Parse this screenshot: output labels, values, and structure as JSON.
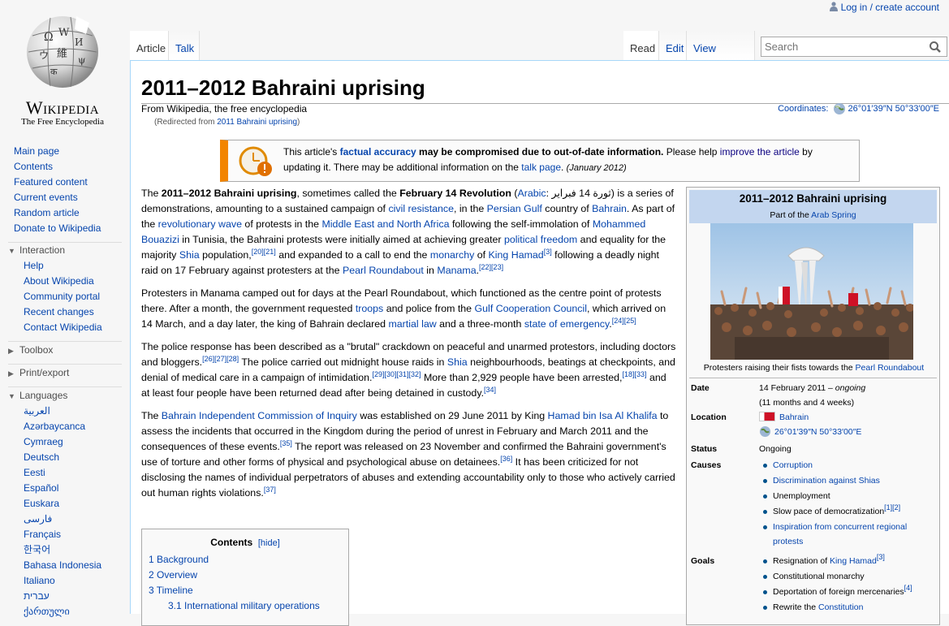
{
  "site": {
    "wordmark": "Wikipedia",
    "tagline": "The Free Encyclopedia"
  },
  "personal": {
    "login": "Log in / create account"
  },
  "nav_main": [
    "Main page",
    "Contents",
    "Featured content",
    "Current events",
    "Random article",
    "Donate to Wikipedia"
  ],
  "interaction": {
    "title": "Interaction",
    "items": [
      "Help",
      "About Wikipedia",
      "Community portal",
      "Recent changes",
      "Contact Wikipedia"
    ]
  },
  "toolbox": {
    "title": "Toolbox"
  },
  "printexport": {
    "title": "Print/export"
  },
  "languages": {
    "title": "Languages",
    "items": [
      "العربية",
      "Azərbaycanca",
      "Cymraeg",
      "Deutsch",
      "Eesti",
      "Español",
      "Euskara",
      "فارسی",
      "Français",
      "한국어",
      "Bahasa Indonesia",
      "Italiano",
      "עברית",
      "ქართული"
    ]
  },
  "tabs": {
    "article": "Article",
    "talk": "Talk",
    "read": "Read",
    "edit": "Edit",
    "history": "View history"
  },
  "search": {
    "placeholder": "Search"
  },
  "page": {
    "title": "2011–2012 Bahraini uprising",
    "site_sub": "From Wikipedia, the free encyclopedia",
    "redirect_pre": "(Redirected from ",
    "redirect_link": "2011 Bahraini uprising",
    "redirect_post": ")",
    "coords_label": "Coordinates:",
    "coords_value": "26°01′39″N 50°33′00″E"
  },
  "ambox": {
    "t1": "This article's ",
    "l1": "factual accuracy",
    "t2": " may be compromised due to out-of-date information.",
    "t3": " Please help ",
    "l2": "improve the article",
    "t4": " by updating it. There may be additional information on the ",
    "l3": "talk page",
    "t5": ". ",
    "date": "(January 2012)"
  },
  "p1": {
    "a": "The ",
    "b": "2011–2012 Bahraini uprising",
    "c": ", sometimes called the ",
    "d": "February 14 Revolution",
    "e": " (",
    "f": "Arabic",
    "g": ": ثورة 14 فبراير",
    "h": ") is a series of demonstrations, amounting to a sustained campaign of ",
    "i": "civil resistance",
    "j": ", in the ",
    "k": "Persian Gulf",
    "l": " country of ",
    "m": "Bahrain",
    "n": ". As part of the ",
    "o": "revolutionary wave",
    "p": " of protests in the ",
    "q": "Middle East and North Africa",
    "r": " following the self-immolation of ",
    "s": "Mohammed Bouazizi",
    "t": " in Tunisia, the Bahraini protests were initially aimed at achieving greater ",
    "u": "political freedom",
    "v": " and equality for the majority ",
    "w": "Shia",
    "x": " population,",
    "x2": "[20][21]",
    "y": " and expanded to a call to end the ",
    "z": "monarchy",
    "aa": " of ",
    "ab": "King Hamad",
    "ab2": "[3]",
    "ac": " following a deadly night raid on 17 February against protesters at the ",
    "ad": "Pearl Roundabout",
    "ae": " in ",
    "af": "Manama",
    "ag": ".",
    "ag2": "[22][23]"
  },
  "p2": {
    "a": "Protesters in Manama camped out for days at the Pearl Roundabout, which functioned as the centre point of protests there. After a month, the government requested ",
    "b": "troops",
    "c": " and police from the ",
    "d": "Gulf Cooperation Council",
    "e": ", which arrived on 14 March, and a day later, the king of Bahrain declared ",
    "f": "martial law",
    "g": " and a three-month ",
    "h": "state of emergency",
    "i": ".",
    "i2": "[24][25]"
  },
  "p3": {
    "a": "The police response has been described as a \"brutal\" crackdown on peaceful and unarmed protestors, including doctors and bloggers.",
    "a2": "[26][27][28]",
    "b": " The police carried out midnight house raids in ",
    "c": "Shia",
    "d": " neighbourhoods, beatings at checkpoints, and denial of medical care in a campaign of intimidation.",
    "d2": "[29][30][31][32]",
    "e": " More than 2,929 people have been arrested,",
    "e2": "[18][33]",
    "f": " and at least four people have been returned dead after being detained in custody.",
    "f2": "[34]"
  },
  "p4": {
    "a": "The ",
    "b": "Bahrain Independent Commission of Inquiry",
    "c": " was established on 29 June 2011 by King ",
    "d": "Hamad bin Isa Al Khalifa",
    "e": " to assess the incidents that occurred in the Kingdom during the period of unrest in February and March 2011 and the consequences of these events.",
    "e2": "[35]",
    "f": " The report was released on 23 November and confirmed the Bahraini government's use of torture and other forms of physical and psychological abuse on detainees.",
    "f2": "[36]",
    "g": " It has been criticized for not disclosing the names of individual perpetrators of abuses and extending accountability only to those who actively carried out human rights violations.",
    "g2": "[37]"
  },
  "toc": {
    "title": "Contents",
    "hide": "[hide]",
    "items": [
      "1 Background",
      "2 Overview",
      "3 Timeline",
      "3.1 International military operations"
    ]
  },
  "infobox": {
    "title": "2011–2012 Bahraini uprising",
    "sub_pre": "Part of the ",
    "sub_link": "Arab Spring",
    "caption_pre": "Protesters raising their fists towards the ",
    "caption_link": "Pearl Roundabout",
    "date_label": "Date",
    "date_value": "14 February 2011 – ",
    "date_status": "ongoing",
    "date_dur": "(11 months and 4 weeks)",
    "location_label": "Location",
    "location_value": "Bahrain",
    "location_coords": "26°01′39″N 50°33′00″E",
    "status_label": "Status",
    "status_value": "Ongoing",
    "causes_label": "Causes",
    "causes": [
      "Corruption",
      "Discrimination against Shias",
      "Unemployment",
      "Slow pace of democratization",
      "Inspiration from concurrent regional protests"
    ],
    "causes_refs": "[1][2]",
    "goals_label": "Goals",
    "goals": [
      "Resignation of ",
      "King Hamad",
      "Constitutional monarchy",
      "Deportation of foreign mercenaries",
      "Rewrite the ",
      "Constitution"
    ],
    "goals_ref1": "[3]",
    "goals_ref2": "[4]"
  }
}
